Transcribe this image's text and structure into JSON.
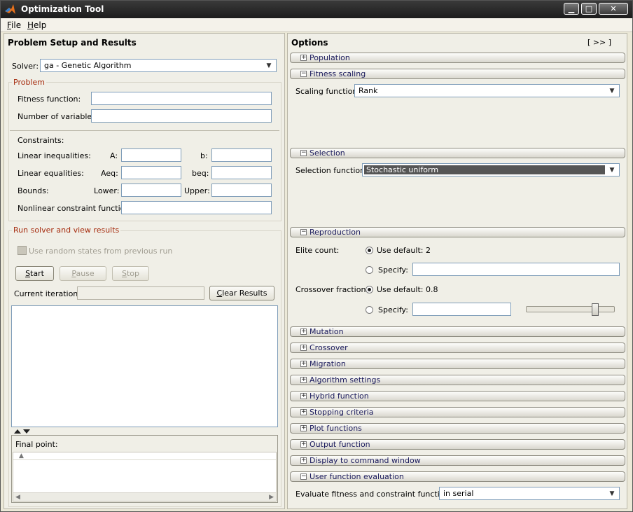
{
  "window": {
    "title": "Optimization Tool",
    "controls": {
      "minimize": "▁",
      "maximize": "□",
      "close": "✕"
    }
  },
  "menu": {
    "file": "File",
    "help": "Help"
  },
  "left": {
    "title": "Problem Setup and Results",
    "solver_label": "Solver:",
    "solver_value": "ga - Genetic Algorithm",
    "problem_heading": "Problem",
    "fitness_label": "Fitness function:",
    "numvars_label": "Number of variables:",
    "constraints_label": "Constraints:",
    "lin_ineq_label": "Linear inequalities:",
    "a_label": "A:",
    "b_label": "b:",
    "lin_eq_label": "Linear equalities:",
    "aeq_label": "Aeq:",
    "beq_label": "beq:",
    "bounds_label": "Bounds:",
    "lower_label": "Lower:",
    "upper_label": "Upper:",
    "nonlin_label": "Nonlinear constraint function:",
    "run_heading": "Run solver and view results",
    "random_states_label": "Use random states from previous run",
    "start": "Start",
    "pause": "Pause",
    "stop": "Stop",
    "current_iter_label": "Current iteration:",
    "clear_results": "Clear Results",
    "final_point_label": "Final point:"
  },
  "right": {
    "title": "Options",
    "expand_button": "[ >> ]",
    "sections": {
      "population": "Population",
      "fitness_scaling": "Fitness scaling",
      "selection": "Selection",
      "reproduction": "Reproduction",
      "mutation": "Mutation",
      "crossover": "Crossover",
      "migration": "Migration",
      "algorithm_settings": "Algorithm settings",
      "hybrid_function": "Hybrid function",
      "stopping_criteria": "Stopping criteria",
      "plot_functions": "Plot functions",
      "output_function": "Output function",
      "display": "Display to command window",
      "user_function_eval": "User function evaluation"
    },
    "scaling_label": "Scaling function:",
    "scaling_value": "Rank",
    "selection_label": "Selection function:",
    "selection_value": "Stochastic uniform",
    "elite_label": "Elite count:",
    "elite_default": "Use default: 2",
    "specify": "Specify:",
    "crossover_label": "Crossover fraction:",
    "crossover_default": "Use default: 0.8",
    "evaluate_label": "Evaluate fitness and constraint functions:",
    "evaluate_value": "in serial",
    "crossover_slider_fraction": 0.8
  }
}
